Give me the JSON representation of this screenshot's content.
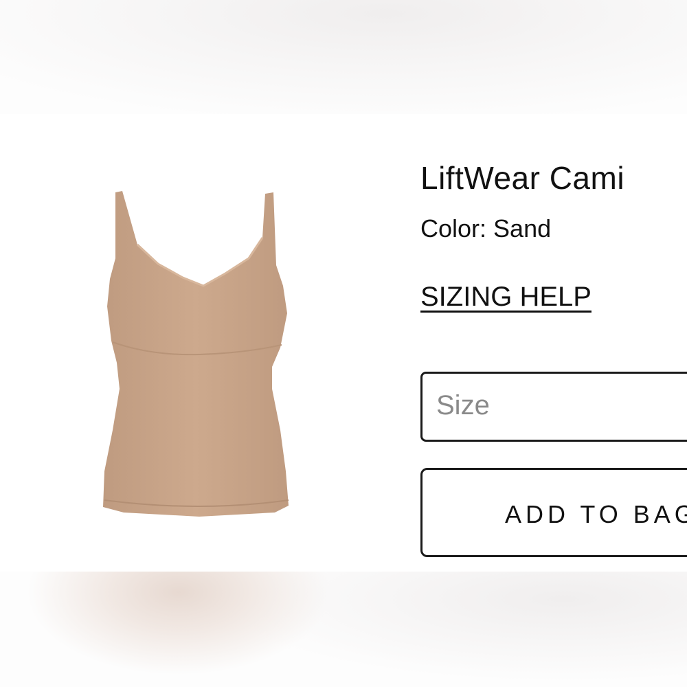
{
  "product": {
    "title": "LiftWear Cami",
    "color_line": "Color: Sand",
    "image_icon": "camisole-product-image",
    "image_color": "#c9a487"
  },
  "links": {
    "sizing_help": "SIZING HELP"
  },
  "size_select": {
    "placeholder": "Size"
  },
  "actions": {
    "add_to_bag": "ADD TO BAG"
  }
}
